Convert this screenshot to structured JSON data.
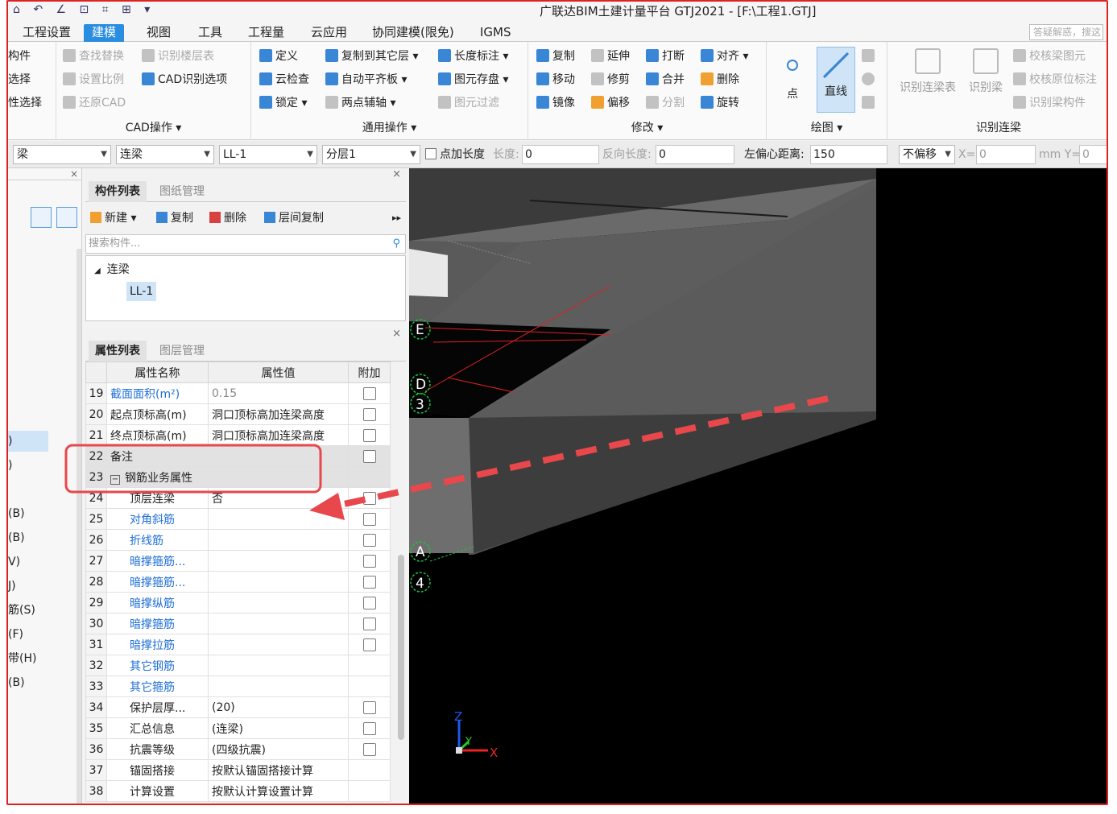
{
  "titlebar": {
    "quick_access": "⌂ ↶ ∠ ⊡ ⌗ ⊞ ▾",
    "title": "广联达BIM土建计量平台 GTJ2021 - [F:\\工程1.GTJ]"
  },
  "menu": {
    "tabs": [
      "工程设置",
      "建模",
      "视图",
      "工具",
      "工程量",
      "云应用",
      "协同建模(限免)",
      "IGMS"
    ],
    "active": "建模",
    "help_placeholder": "答疑解惑，搜这"
  },
  "ribbon": {
    "select_group": [
      "构件",
      "选择",
      "性选择"
    ],
    "cad": {
      "items": [
        "查找替换",
        "识别楼层表",
        "设置比例",
        "CAD识别选项",
        "还原CAD"
      ],
      "label": "CAD操作 ▾"
    },
    "general": {
      "items": [
        "定义",
        "复制到其它层 ▾",
        "长度标注 ▾",
        "云检查",
        "自动平齐板 ▾",
        "图元存盘 ▾",
        "锁定 ▾",
        "两点辅轴 ▾",
        "图元过滤"
      ],
      "label": "通用操作 ▾"
    },
    "modify": {
      "items": [
        "复制",
        "延伸",
        "打断",
        "对齐 ▾",
        "移动",
        "修剪",
        "合并",
        "删除",
        "镜像",
        "偏移",
        "分割",
        "旋转"
      ],
      "label": "修改 ▾"
    },
    "draw": {
      "point": "点",
      "line": "直线",
      "label": "绘图 ▾"
    },
    "recognize": {
      "big": [
        "识别连梁表",
        "识别梁"
      ],
      "items": [
        "校核梁图元",
        "校核原位标注",
        "识别梁构件"
      ],
      "label": "识别连梁"
    }
  },
  "propbar": {
    "type": "梁",
    "subtype": "连梁",
    "component": "LL-1",
    "layer": "分层1",
    "add_length_label": "点加长度",
    "length_label": "长度:",
    "length_value": "0",
    "reverse_label": "反向长度:",
    "reverse_value": "0",
    "offset_label": "左偏心距离:",
    "offset_value": "150",
    "mode": "不偏移",
    "x_label": "X=",
    "x_value": "0",
    "unit_y": "mm Y=",
    "y_value": "0"
  },
  "left_strip": {
    "items": [
      ")",
      ")",
      "(B)",
      "(B)",
      "V)",
      "J)",
      "筋(S)",
      "(F)",
      "带(H)",
      "(B)"
    ]
  },
  "component_list": {
    "tabs": [
      "构件列表",
      "图纸管理"
    ],
    "tools": [
      "新建 ▾",
      "复制",
      "删除",
      "层间复制"
    ],
    "search_placeholder": "搜索构件...",
    "tree_root": "连梁",
    "tree_leaf": "LL-1"
  },
  "properties": {
    "tabs": [
      "属性列表",
      "图层管理"
    ],
    "headers": [
      "属性名称",
      "属性值",
      "附加"
    ],
    "rows": [
      {
        "num": "19",
        "name": "截面面积(m²)",
        "value": "0.15",
        "chk": true,
        "style": "link",
        "vstyle": "gray"
      },
      {
        "num": "20",
        "name": "起点顶标高(m)",
        "value": "洞口顶标高加连梁高度",
        "chk": true
      },
      {
        "num": "21",
        "name": "终点顶标高(m)",
        "value": "洞口顶标高加连梁高度",
        "chk": true
      },
      {
        "num": "22",
        "name": "备注",
        "value": "",
        "chk": true,
        "hl": true
      },
      {
        "num": "23",
        "name": "钢筋业务属性",
        "value": "",
        "chk": false,
        "hl": true,
        "group": true
      },
      {
        "num": "24",
        "name": "顶层连梁",
        "value": "否",
        "chk": true,
        "indent": true
      },
      {
        "num": "25",
        "name": "对角斜筋",
        "value": "",
        "chk": true,
        "indent": true,
        "style": "link"
      },
      {
        "num": "26",
        "name": "折线筋",
        "value": "",
        "chk": true,
        "indent": true,
        "style": "link"
      },
      {
        "num": "27",
        "name": "暗撑箍筋...",
        "value": "",
        "chk": true,
        "indent": true,
        "style": "link"
      },
      {
        "num": "28",
        "name": "暗撑箍筋...",
        "value": "",
        "chk": true,
        "indent": true,
        "style": "link"
      },
      {
        "num": "29",
        "name": "暗撑纵筋",
        "value": "",
        "chk": true,
        "indent": true,
        "style": "link"
      },
      {
        "num": "30",
        "name": "暗撑箍筋",
        "value": "",
        "chk": true,
        "indent": true,
        "style": "link"
      },
      {
        "num": "31",
        "name": "暗撑拉筋",
        "value": "",
        "chk": true,
        "indent": true,
        "style": "link"
      },
      {
        "num": "32",
        "name": "其它钢筋",
        "value": "",
        "chk": false,
        "indent": true,
        "style": "link"
      },
      {
        "num": "33",
        "name": "其它箍筋",
        "value": "",
        "chk": false,
        "indent": true,
        "style": "link"
      },
      {
        "num": "34",
        "name": "保护层厚...",
        "value": "(20)",
        "chk": true,
        "indent": true
      },
      {
        "num": "35",
        "name": "汇总信息",
        "value": "(连梁)",
        "chk": true,
        "indent": true
      },
      {
        "num": "36",
        "name": "抗震等级",
        "value": "(四级抗震)",
        "chk": true,
        "indent": true
      },
      {
        "num": "37",
        "name": "锚固搭接",
        "value": "按默认锚固搭接计算",
        "chk": false,
        "indent": true
      },
      {
        "num": "38",
        "name": "计算设置",
        "value": "按默认计算设置计算",
        "chk": false,
        "indent": true
      }
    ]
  },
  "viewport": {
    "axis_labels": [
      "E",
      "D",
      "3",
      "A",
      "4"
    ],
    "axis_x": "X",
    "axis_y": "Y",
    "axis_z": "Z"
  },
  "colors": {
    "accent": "#2a8de0",
    "annotation": "#e8474b",
    "grid_red": "#e02020",
    "axis_green": "#20c040"
  }
}
